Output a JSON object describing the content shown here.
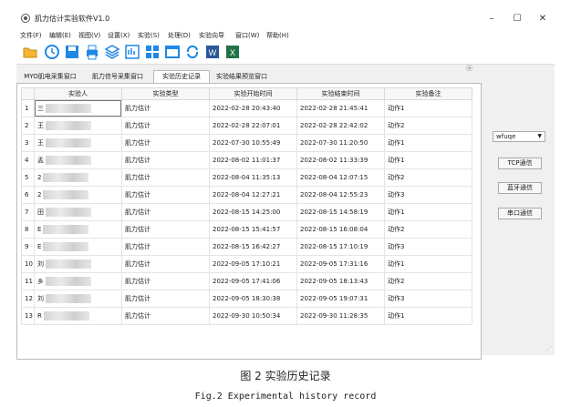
{
  "window": {
    "title": "肌力估计实验软件V1.0"
  },
  "window_controls": {
    "minimize": "–",
    "maximize": "☐",
    "close": "✕"
  },
  "menu": [
    "文件(F)",
    "编辑(E)",
    "视图(V)",
    "设置(X)",
    "实验(S)",
    "处理(D)",
    "实验向导",
    "窗口(W)",
    "帮助(H)"
  ],
  "toolbar_icons": [
    "folder-open-icon",
    "refresh-icon",
    "save-icon",
    "print-icon",
    "layers-icon",
    "data-icon",
    "grid-icon",
    "window-icon",
    "sync-icon",
    "word-icon",
    "excel-icon"
  ],
  "tabs": [
    {
      "label": "MYO肌电采集窗口",
      "active": false
    },
    {
      "label": "肌力信号采集窗口",
      "active": false
    },
    {
      "label": "实验历史记录",
      "active": true
    },
    {
      "label": "实验结果预览窗口",
      "active": false
    }
  ],
  "pin": "ⓐ",
  "table": {
    "headers": [
      "实验人",
      "实验类型",
      "实验开始时间",
      "实验结束时间",
      "实验备注"
    ],
    "rows": [
      {
        "num": "1",
        "person": "三",
        "type": "肌力估计",
        "start": "2022-02-28 20:43:40",
        "end": "2022-02-28 21:45:41",
        "note": "动作1"
      },
      {
        "num": "2",
        "person": "王",
        "type": "肌力估计",
        "start": "2022-02-28 22:07:01",
        "end": "2022-02-28 22:42:02",
        "note": "动作2"
      },
      {
        "num": "3",
        "person": "王",
        "type": "肌力估计",
        "start": "2022-07-30 10:55:49",
        "end": "2022-07-30 11:20:50",
        "note": "动作1"
      },
      {
        "num": "4",
        "person": "孟",
        "type": "肌力估计",
        "start": "2022-08-02 11:01:37",
        "end": "2022-08-02 11:33:39",
        "note": "动作1"
      },
      {
        "num": "5",
        "person": "2",
        "type": "肌力估计",
        "start": "2022-08-04 11:35:13",
        "end": "2022-08-04 12:07:15",
        "note": "动作2"
      },
      {
        "num": "6",
        "person": "2",
        "type": "肌力估计",
        "start": "2022-08-04 12:27:21",
        "end": "2022-08-04 12:55:23",
        "note": "动作3"
      },
      {
        "num": "7",
        "person": "田",
        "type": "肌力估计",
        "start": "2022-08-15 14:25:00",
        "end": "2022-08-15 14:58:19",
        "note": "动作1"
      },
      {
        "num": "8",
        "person": "E",
        "type": "肌力估计",
        "start": "2022-08-15 15:41:57",
        "end": "2022-08-15 16:08:04",
        "note": "动作2"
      },
      {
        "num": "9",
        "person": "E",
        "type": "肌力估计",
        "start": "2022-08-15 16:42:27",
        "end": "2022-08-15 17:10:19",
        "note": "动作3"
      },
      {
        "num": "10",
        "person": "刘",
        "type": "肌力估计",
        "start": "2022-09-05 17:10:21",
        "end": "2022-09-05 17:31:16",
        "note": "动作1"
      },
      {
        "num": "11",
        "person": "乡",
        "type": "肌力估计",
        "start": "2022-09-05 17:41:06",
        "end": "2022-09-05 18:13:43",
        "note": "动作2"
      },
      {
        "num": "12",
        "person": "刘",
        "type": "肌力估计",
        "start": "2022-09-05 18:30:38",
        "end": "2022-09-05 19:07:31",
        "note": "动作3"
      },
      {
        "num": "13",
        "person": "R",
        "type": "肌力估计",
        "start": "2022-09-30 10:50:34",
        "end": "2022-09-30 11:28:35",
        "note": "动作1"
      }
    ]
  },
  "side": {
    "select_value": "wfuqe",
    "buttons": [
      "TCP通信",
      "蓝牙通信",
      "串口通信"
    ]
  },
  "grip": "⋰",
  "caption": {
    "cn": "图 2 实验历史记录",
    "en": "Fig.2 Experimental history record"
  }
}
